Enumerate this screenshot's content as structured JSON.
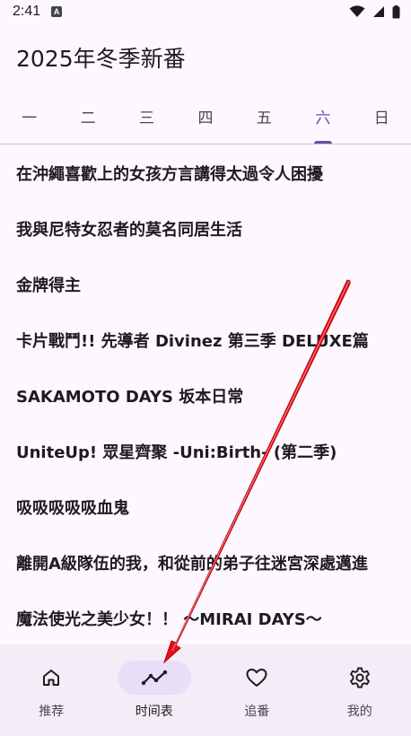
{
  "status_bar": {
    "time": "2:41",
    "notification_icon": "a-letter-icon"
  },
  "header": {
    "title": "2025年冬季新番"
  },
  "weekday_tabs": [
    {
      "label": "一",
      "active": false
    },
    {
      "label": "二",
      "active": false
    },
    {
      "label": "三",
      "active": false
    },
    {
      "label": "四",
      "active": false
    },
    {
      "label": "五",
      "active": false
    },
    {
      "label": "六",
      "active": true
    },
    {
      "label": "日",
      "active": false
    }
  ],
  "anime_list": [
    "在沖繩喜歡上的女孩方言講得太過令人困擾",
    "我與尼特女忍者的莫名同居生活",
    "金牌得主",
    "卡片戰鬥!! 先導者 Divinez 第三季 DELUXE篇",
    "SAKAMOTO DAYS 坂本日常",
    "UniteUp! 眾星齊聚 -Uni:Birth- (第二季)",
    "吸吸吸吸吸血鬼",
    "離開A級隊伍的我，和從前的弟子往迷宮深處邁進",
    "魔法使光之美少女！！ ～MIRAI DAYS～"
  ],
  "bottom_nav": [
    {
      "label": "推荐",
      "icon": "home-icon",
      "active": false
    },
    {
      "label": "时间表",
      "icon": "trend-line-icon",
      "active": true
    },
    {
      "label": "追番",
      "icon": "heart-icon",
      "active": false
    },
    {
      "label": "我的",
      "icon": "gear-icon",
      "active": false
    }
  ],
  "colors": {
    "accent": "#6750a4",
    "background": "#fdf7ff",
    "nav_background": "#f3edf7",
    "nav_active_pill": "#e8def8",
    "annotation_arrow": "#e8101a"
  }
}
